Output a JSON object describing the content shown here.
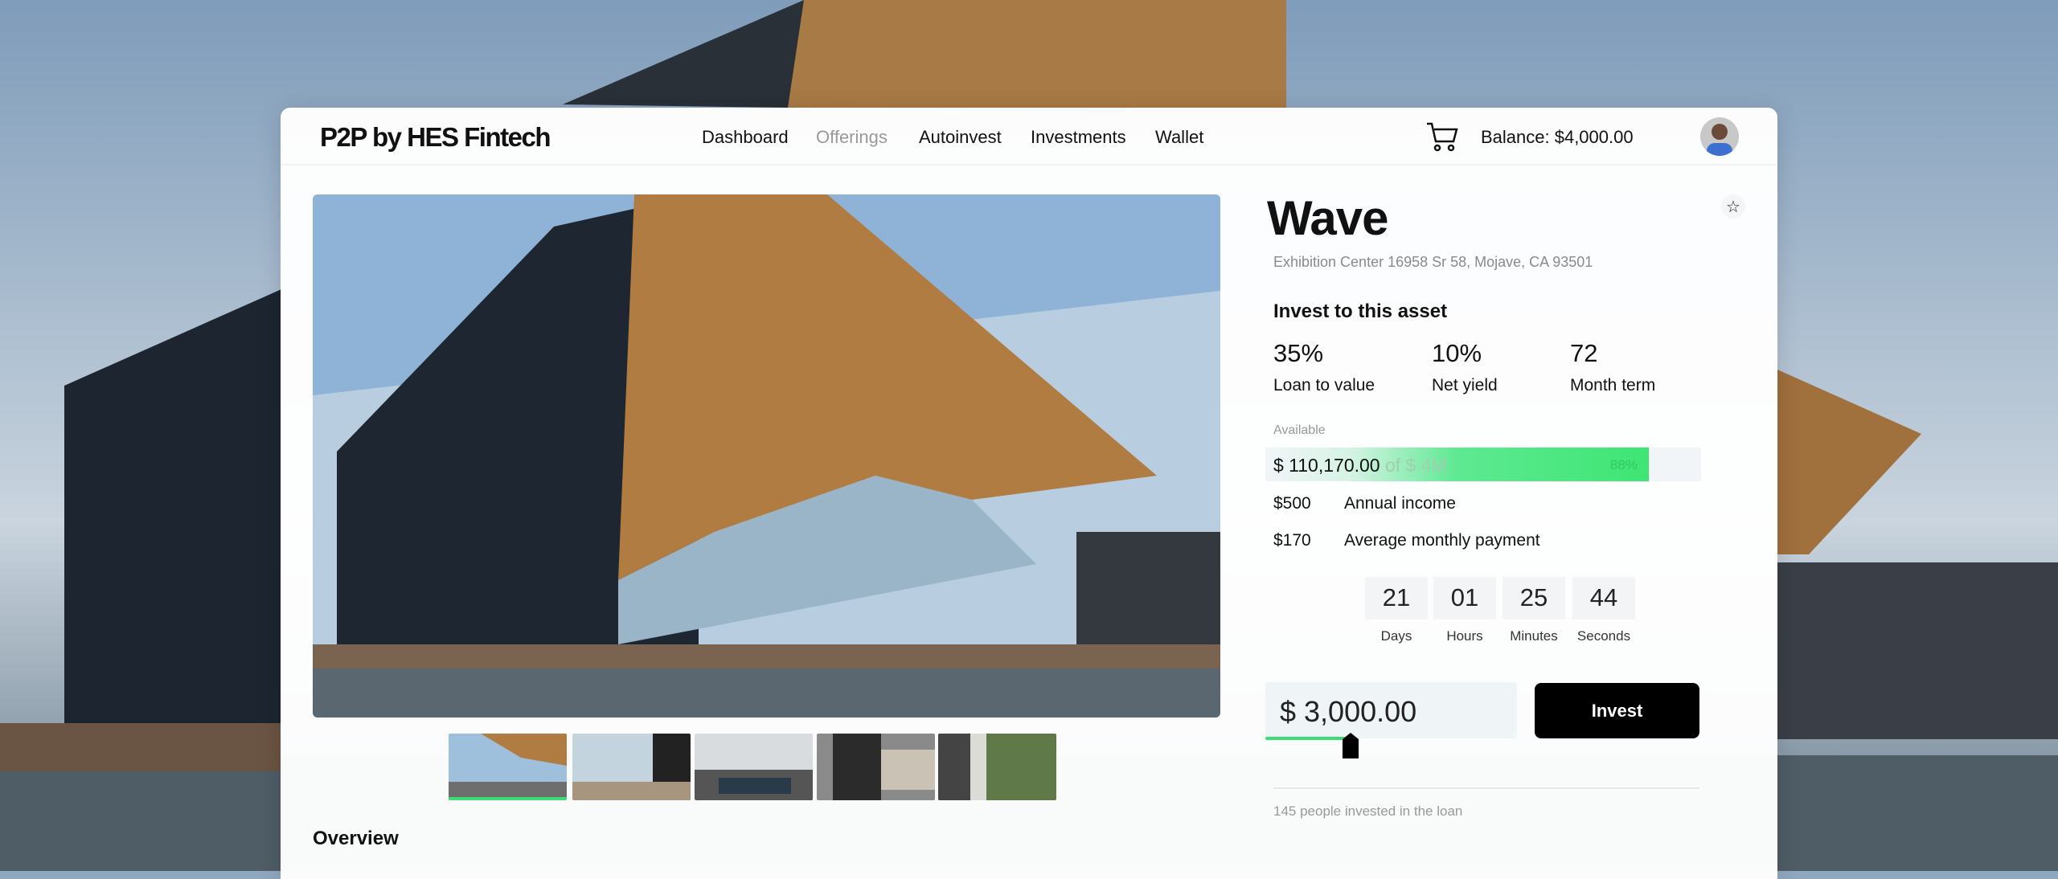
{
  "header": {
    "logo": "P2P by HES Fintech",
    "nav": [
      {
        "label": "Dashboard",
        "active": false
      },
      {
        "label": "Offerings",
        "active": true
      },
      {
        "label": "Autoinvest",
        "active": false
      },
      {
        "label": "Investments",
        "active": false
      },
      {
        "label": "Wallet",
        "active": false
      }
    ],
    "cart_icon": "cart-icon",
    "balance": "Balance: $4,000.00"
  },
  "gallery": {
    "thumbnail_count": 5,
    "active_index": 0
  },
  "overview_label": "Overview",
  "asset": {
    "title": "Wave",
    "address": "Exhibition Center  16958 Sr 58, Mojave, CA 93501",
    "subtitle": "Invest to this asset",
    "stats": [
      {
        "value": "35%",
        "label": "Loan to value"
      },
      {
        "value": "10%",
        "label": "Net yield"
      },
      {
        "value": "72",
        "label": "Month term"
      }
    ],
    "available_label": "Available",
    "available_amount": "$ 110,170.00",
    "available_total": "of $ 4M",
    "funded_percent_label": "88%",
    "funded_percent": 88,
    "facts": [
      {
        "value": "$500",
        "label": "Annual income"
      },
      {
        "value": "$170",
        "label": "Average monthly payment"
      }
    ],
    "countdown": [
      {
        "value": "21",
        "label": "Days"
      },
      {
        "value": "01",
        "label": "Hours"
      },
      {
        "value": "25",
        "label": "Minutes"
      },
      {
        "value": "44",
        "label": "Seconds"
      }
    ],
    "amount": "$ 3,000.00",
    "invest_label": "Invest",
    "people": "145 people invested in the loan"
  },
  "colors": {
    "accent": "#3ddc74",
    "button": "#000000"
  }
}
